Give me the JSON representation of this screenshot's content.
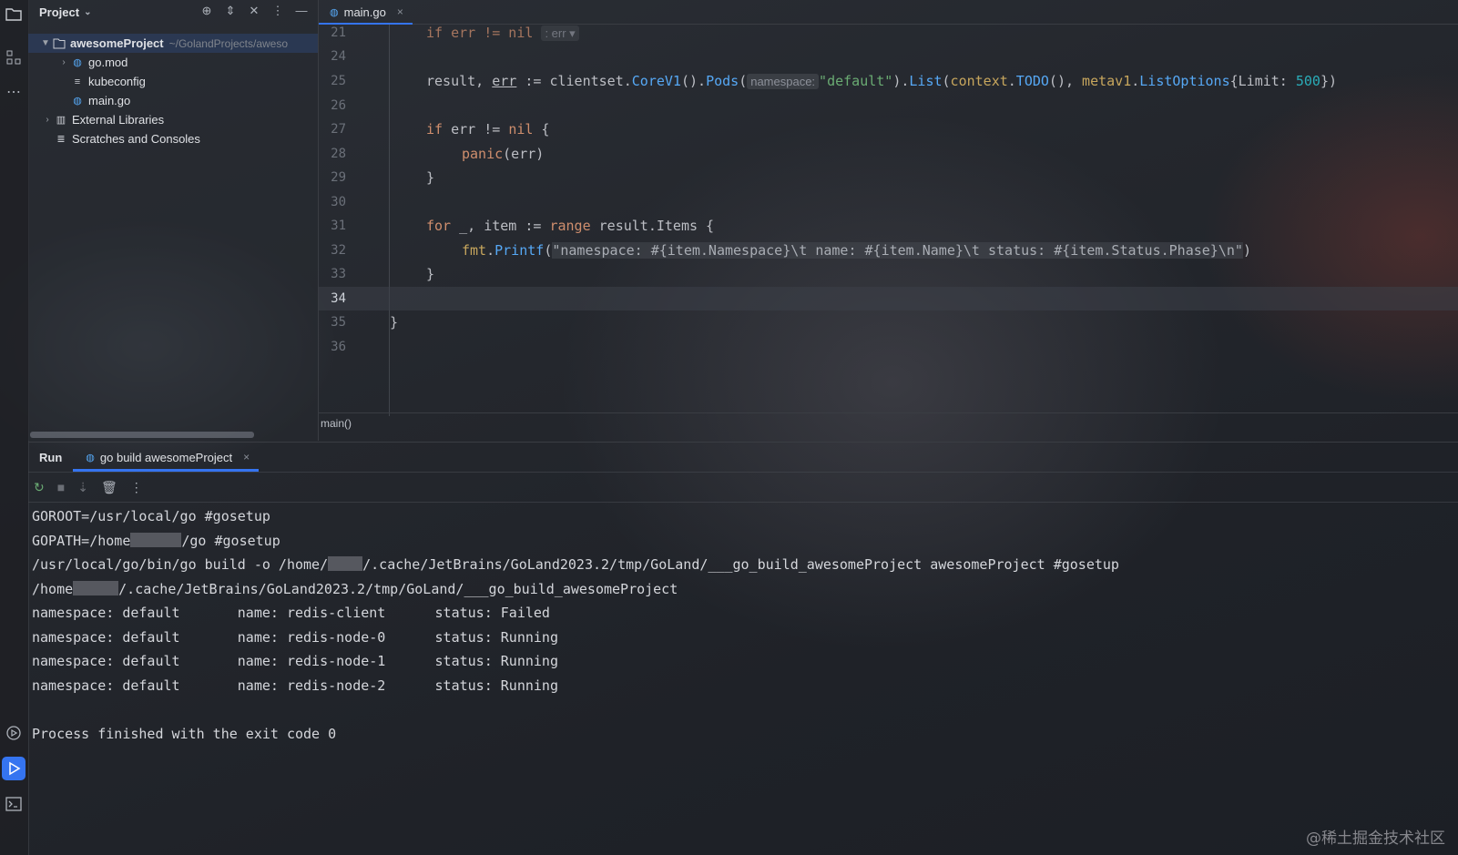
{
  "project_panel": {
    "title": "Project",
    "tree": [
      {
        "label": "awesomeProject",
        "path": "~/GolandProjects/aweso",
        "icon": "folder-icon"
      },
      {
        "label": "go.mod",
        "icon": "gomod-icon"
      },
      {
        "label": "kubeconfig",
        "icon": "text-file-icon"
      },
      {
        "label": "main.go",
        "icon": "go-file-icon"
      },
      {
        "label": "External Libraries",
        "icon": "library-icon"
      },
      {
        "label": "Scratches and Consoles",
        "icon": "scratches-icon"
      }
    ]
  },
  "editor": {
    "tab": "main.go",
    "line_numbers": [
      "21",
      "24",
      "25",
      "26",
      "27",
      "28",
      "29",
      "30",
      "31",
      "32",
      "33",
      "34",
      "35",
      "36"
    ],
    "line21": {
      "a": "if err != nil ",
      "hint": ": err ▾"
    },
    "line25": {
      "a": "result, ",
      "err": "err",
      "b": " := clientset.",
      "corev1": "CoreV1",
      "c": "().",
      "pods": "Pods",
      "d": "(",
      "hint": "namespace:",
      "e": " ",
      "str": "\"default\"",
      "f": ").",
      "list": "List",
      "g": "(",
      "context": "context",
      "h": ".",
      "todo": "TODO",
      "i": "(), ",
      "metav1": "metav1",
      "j": ".",
      "listoptions": "ListOptions",
      "k": "{Limit: ",
      "num": "500",
      "l": "})"
    },
    "line27": {
      "kw": "if",
      "rest": " err != ",
      "nil": "nil",
      "end": " {"
    },
    "line28": {
      "fn": "panic",
      "rest": "(err)"
    },
    "line29": "}",
    "line31": {
      "kw": "for",
      "a": " _, item := ",
      "range": "range",
      "b": " result.Items {"
    },
    "line32": {
      "pkg": "fmt",
      "dot": ".",
      "fn": "Printf",
      "open": "(",
      "str": "\"namespace: #{item.Namespace}\\t name: #{item.Name}\\t status: #{item.Status.Phase}\\n\"",
      "close": ")"
    },
    "line33": "}",
    "line35": "}",
    "breadcrumb": "main()"
  },
  "run_panel": {
    "title": "Run",
    "tab": "go build awesomeProject",
    "console": [
      {
        "a": "GOROOT=/usr/local/go #gosetup"
      },
      {
        "a": "GOPATH=/home",
        "b": "/go #gosetup"
      },
      {
        "a": "/usr/local/go/bin/go build -o /home/",
        "b": "/.cache/JetBrains/GoLand2023.2/tmp/GoLand/___go_build_awesomeProject awesomeProject #gosetup"
      },
      {
        "a": "/home",
        "b": "/.cache/JetBrains/GoLand2023.2/tmp/GoLand/___go_build_awesomeProject"
      },
      {
        "a": "namespace: default       name: redis-client      status: Failed"
      },
      {
        "a": "namespace: default       name: redis-node-0      status: Running"
      },
      {
        "a": "namespace: default       name: redis-node-1      status: Running"
      },
      {
        "a": "namespace: default       name: redis-node-2      status: Running"
      },
      {
        "a": ""
      },
      {
        "a": "Process finished with the exit code 0"
      }
    ]
  },
  "watermark": "@稀土掘金技术社区",
  "colors": {
    "accent": "#3574f0",
    "keyword": "#cf8e6d",
    "function": "#56a8f5",
    "string": "#6aab73",
    "number": "#2aacb8"
  }
}
